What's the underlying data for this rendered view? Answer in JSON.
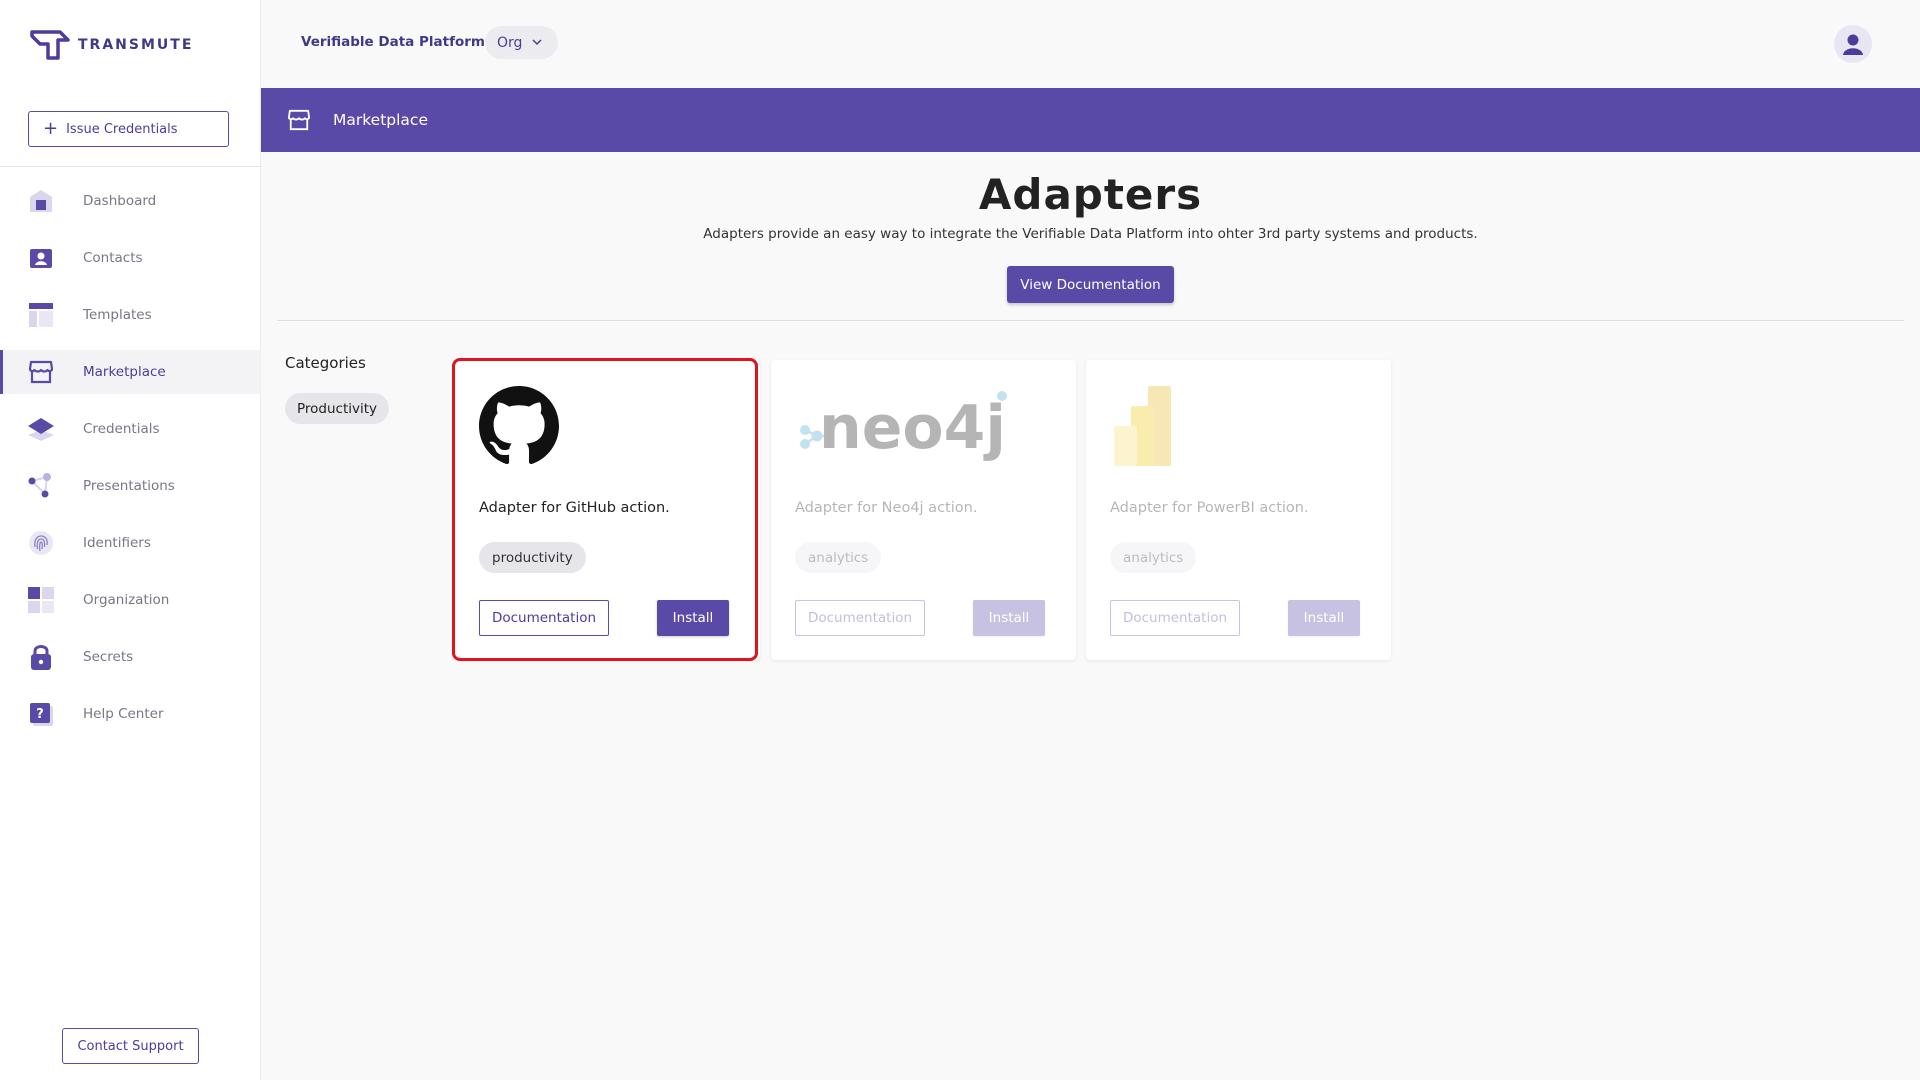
{
  "brand": {
    "name": "TRANSMUTE"
  },
  "sidebar": {
    "issue_button": "Issue Credentials",
    "items": [
      {
        "label": "Dashboard",
        "icon": "house-icon"
      },
      {
        "label": "Contacts",
        "icon": "contact-card-icon"
      },
      {
        "label": "Templates",
        "icon": "template-layout-icon"
      },
      {
        "label": "Marketplace",
        "icon": "storefront-icon",
        "active": true
      },
      {
        "label": "Credentials",
        "icon": "layers-icon"
      },
      {
        "label": "Presentations",
        "icon": "share-nodes-icon"
      },
      {
        "label": "Identifiers",
        "icon": "fingerprint-icon"
      },
      {
        "label": "Organization",
        "icon": "grid-blocks-icon"
      },
      {
        "label": "Secrets",
        "icon": "lock-icon"
      },
      {
        "label": "Help Center",
        "icon": "help-question-icon"
      }
    ],
    "contact_support": "Contact Support"
  },
  "topbar": {
    "platform_title": "Verifiable Data Platform",
    "org_select": "Org"
  },
  "banner": {
    "title": "Marketplace",
    "icon": "storefront-icon"
  },
  "main": {
    "title": "Adapters",
    "description": "Adapters provide an easy way to integrate the Verifiable Data Platform into ohter 3rd party systems and products.",
    "view_doc_button": "View Documentation",
    "categories_title": "Categories",
    "categories": [
      "Productivity"
    ]
  },
  "cards": [
    {
      "logo": "github-icon",
      "description": "Adapter for GitHub action.",
      "tag": "productivity",
      "doc_button": "Documentation",
      "install_button": "Install",
      "highlighted": true
    },
    {
      "logo": "neo4j-logo",
      "logo_text": "neo4j",
      "description": "Adapter for Neo4j action.",
      "tag": "analytics",
      "doc_button": "Documentation",
      "install_button": "Install",
      "dimmed": true
    },
    {
      "logo": "powerbi-logo",
      "description": "Adapter for PowerBI action.",
      "tag": "analytics",
      "doc_button": "Documentation",
      "install_button": "Install",
      "dimmed": true
    }
  ],
  "colors": {
    "brand": "#5a4aa8",
    "highlight": "#e0141c"
  }
}
